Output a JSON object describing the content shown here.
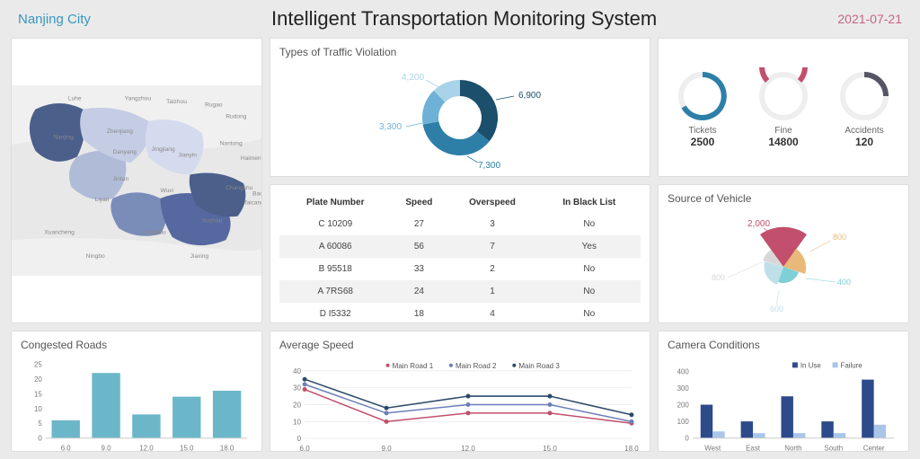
{
  "header": {
    "city": "Nanjing City",
    "title": "Intelligent Transportation Monitoring System",
    "date": "2021-07-21"
  },
  "panels": {
    "violation_title": "Types of Traffic Violation",
    "source_title": "Source of Vehicle",
    "congested_title": "Congested Roads",
    "speed_title": "Average Speed",
    "camera_title": "Camera Conditions"
  },
  "kpi": {
    "tickets_label": "Tickets",
    "tickets_value": "2500",
    "fine_label": "Fine",
    "fine_value": "14800",
    "accidents_label": "Accidents",
    "accidents_value": "120"
  },
  "table": {
    "headers": {
      "plate": "Plate Number",
      "speed": "Speed",
      "over": "Overspeed",
      "black": "In Black List"
    },
    "rows": [
      {
        "plate": "C 10209",
        "speed": "27",
        "over": "3",
        "black": "No"
      },
      {
        "plate": "A 60086",
        "speed": "56",
        "over": "7",
        "black": "Yes"
      },
      {
        "plate": "B 95518",
        "speed": "33",
        "over": "2",
        "black": "No"
      },
      {
        "plate": "A 7RS68",
        "speed": "24",
        "over": "1",
        "black": "No"
      },
      {
        "plate": "D I5332",
        "speed": "18",
        "over": "4",
        "black": "No"
      }
    ]
  },
  "chart_data": [
    {
      "type": "pie",
      "title": "Types of Traffic Violation",
      "labels": [
        "6,900",
        "7,300",
        "3,300",
        "4,200"
      ],
      "values": [
        6900,
        7300,
        3300,
        4200
      ],
      "colors": [
        "#1b4f6b",
        "#2d7fa8",
        "#6db2d6",
        "#a9d3e8"
      ]
    },
    {
      "type": "pie",
      "title": "Source of Vehicle",
      "labels": [
        "2,000",
        "800",
        "400",
        "600",
        "800"
      ],
      "values": [
        2000,
        800,
        400,
        600,
        800
      ],
      "colors": [
        "#c24f6b",
        "#e8b97a",
        "#7ecfd6",
        "#bfe0e8",
        "#d8d8d8"
      ]
    },
    {
      "type": "bar",
      "title": "Congested Roads",
      "categories": [
        "6.0",
        "9.0",
        "12.0",
        "15.0",
        "18.0"
      ],
      "values": [
        6,
        22,
        8,
        14,
        16
      ],
      "ylim": [
        0,
        25
      ],
      "yticks": [
        0,
        5,
        10,
        15,
        20,
        25
      ],
      "color": "#6bb7c9"
    },
    {
      "type": "line",
      "title": "Average Speed",
      "x": [
        "6.0",
        "9.0",
        "12.0",
        "15.0",
        "18.0"
      ],
      "series": [
        {
          "name": "Main Road 1",
          "values": [
            29,
            10,
            15,
            15,
            9
          ],
          "color": "#c24f6b"
        },
        {
          "name": "Main Road 2",
          "values": [
            32,
            15,
            20,
            20,
            10
          ],
          "color": "#6b7fb8"
        },
        {
          "name": "Main Road 3",
          "values": [
            35,
            18,
            25,
            25,
            14
          ],
          "color": "#2d4a6b"
        }
      ],
      "ylim": [
        0,
        40
      ],
      "yticks": [
        0,
        10,
        20,
        30,
        40
      ]
    },
    {
      "type": "bar",
      "title": "Camera Conditions",
      "categories": [
        "West",
        "East",
        "North",
        "South",
        "Center"
      ],
      "series": [
        {
          "name": "In Use",
          "values": [
            200,
            100,
            250,
            100,
            350
          ],
          "color": "#2d4a8a"
        },
        {
          "name": "Failure",
          "values": [
            40,
            30,
            30,
            30,
            80
          ],
          "color": "#a9c5e8"
        }
      ],
      "ylim": [
        0,
        400
      ],
      "yticks": [
        0,
        100,
        200,
        300,
        400
      ]
    }
  ],
  "map": {
    "regions": [
      "Luhe",
      "Yangzhou",
      "Taizhou",
      "Rugao",
      "Rudong",
      "Nantong",
      "Haimen",
      "Nanjing",
      "Zhenjiang",
      "Danyang",
      "Jingjiang",
      "Jianyin",
      "Changshu",
      "Taicang",
      "Baosh",
      "Wuxi",
      "Liyan",
      "Jintan",
      "Suzhou",
      "Xuancheng",
      "Huzhou",
      "Jiaxing",
      "Ningbo"
    ]
  }
}
